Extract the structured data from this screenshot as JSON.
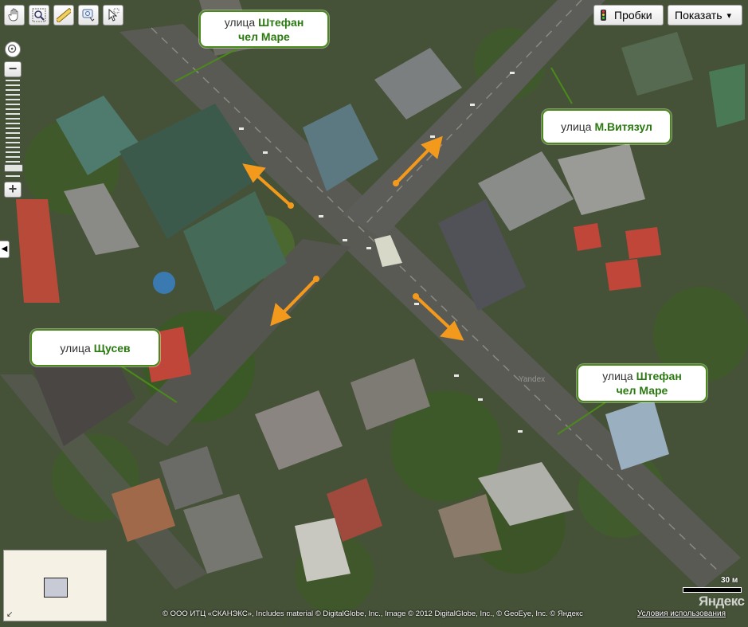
{
  "toolbar": {
    "tools": [
      {
        "icon": "hand-icon"
      },
      {
        "icon": "magnifier-icon"
      },
      {
        "icon": "ruler-icon"
      },
      {
        "icon": "print-icon"
      },
      {
        "icon": "cursor-icon"
      }
    ],
    "traffic_label": "Пробки",
    "show_label": "Показать",
    "show_arrow": "▾"
  },
  "callouts": [
    {
      "prefix": "улица",
      "name_line1": "Штефан",
      "name_line2": "чел Маре"
    },
    {
      "prefix": "улица",
      "name": "М.Витязул"
    },
    {
      "prefix": "улица",
      "name": "Щусев"
    },
    {
      "prefix": "улица",
      "name_line1": "Штефан",
      "name_line2": "чел Маре"
    }
  ],
  "zoom": {
    "plus": "+",
    "minus": "−"
  },
  "watermark": "Yandex",
  "scale": {
    "label": "30 м"
  },
  "brand": "Яндекс",
  "copyright": "© ООО ИТЦ «СКАНЭКС», Includes material © DigitalGlobe, Inc., Image © 2012 DigitalGlobe, Inc., © GeoEye, Inc. © Яндекс",
  "terms": "Условия использования",
  "colors": {
    "callout_border": "#4a8a1a",
    "street_name": "#2a7a10",
    "arrow": "#f39a1c"
  }
}
